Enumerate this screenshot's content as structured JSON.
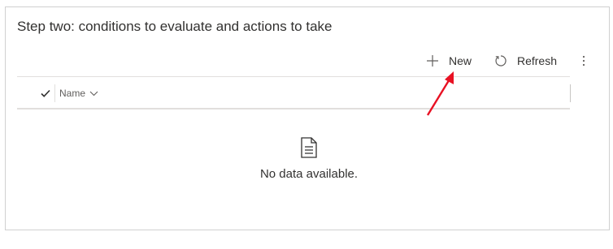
{
  "section": {
    "title": "Step two: conditions to evaluate and actions to take"
  },
  "toolbar": {
    "new_label": "New",
    "refresh_label": "Refresh",
    "icons": {
      "new": "plus-icon",
      "refresh": "refresh-icon",
      "more": "more-vertical-icon"
    }
  },
  "grid": {
    "columns": [
      {
        "label": "Name"
      }
    ],
    "icons": {
      "select_all": "checkmark-icon",
      "sort": "chevron-down-icon"
    }
  },
  "empty_state": {
    "message": "No data available.",
    "icon": "document-icon"
  },
  "annotation": {
    "type": "arrow",
    "color": "#e81123"
  }
}
